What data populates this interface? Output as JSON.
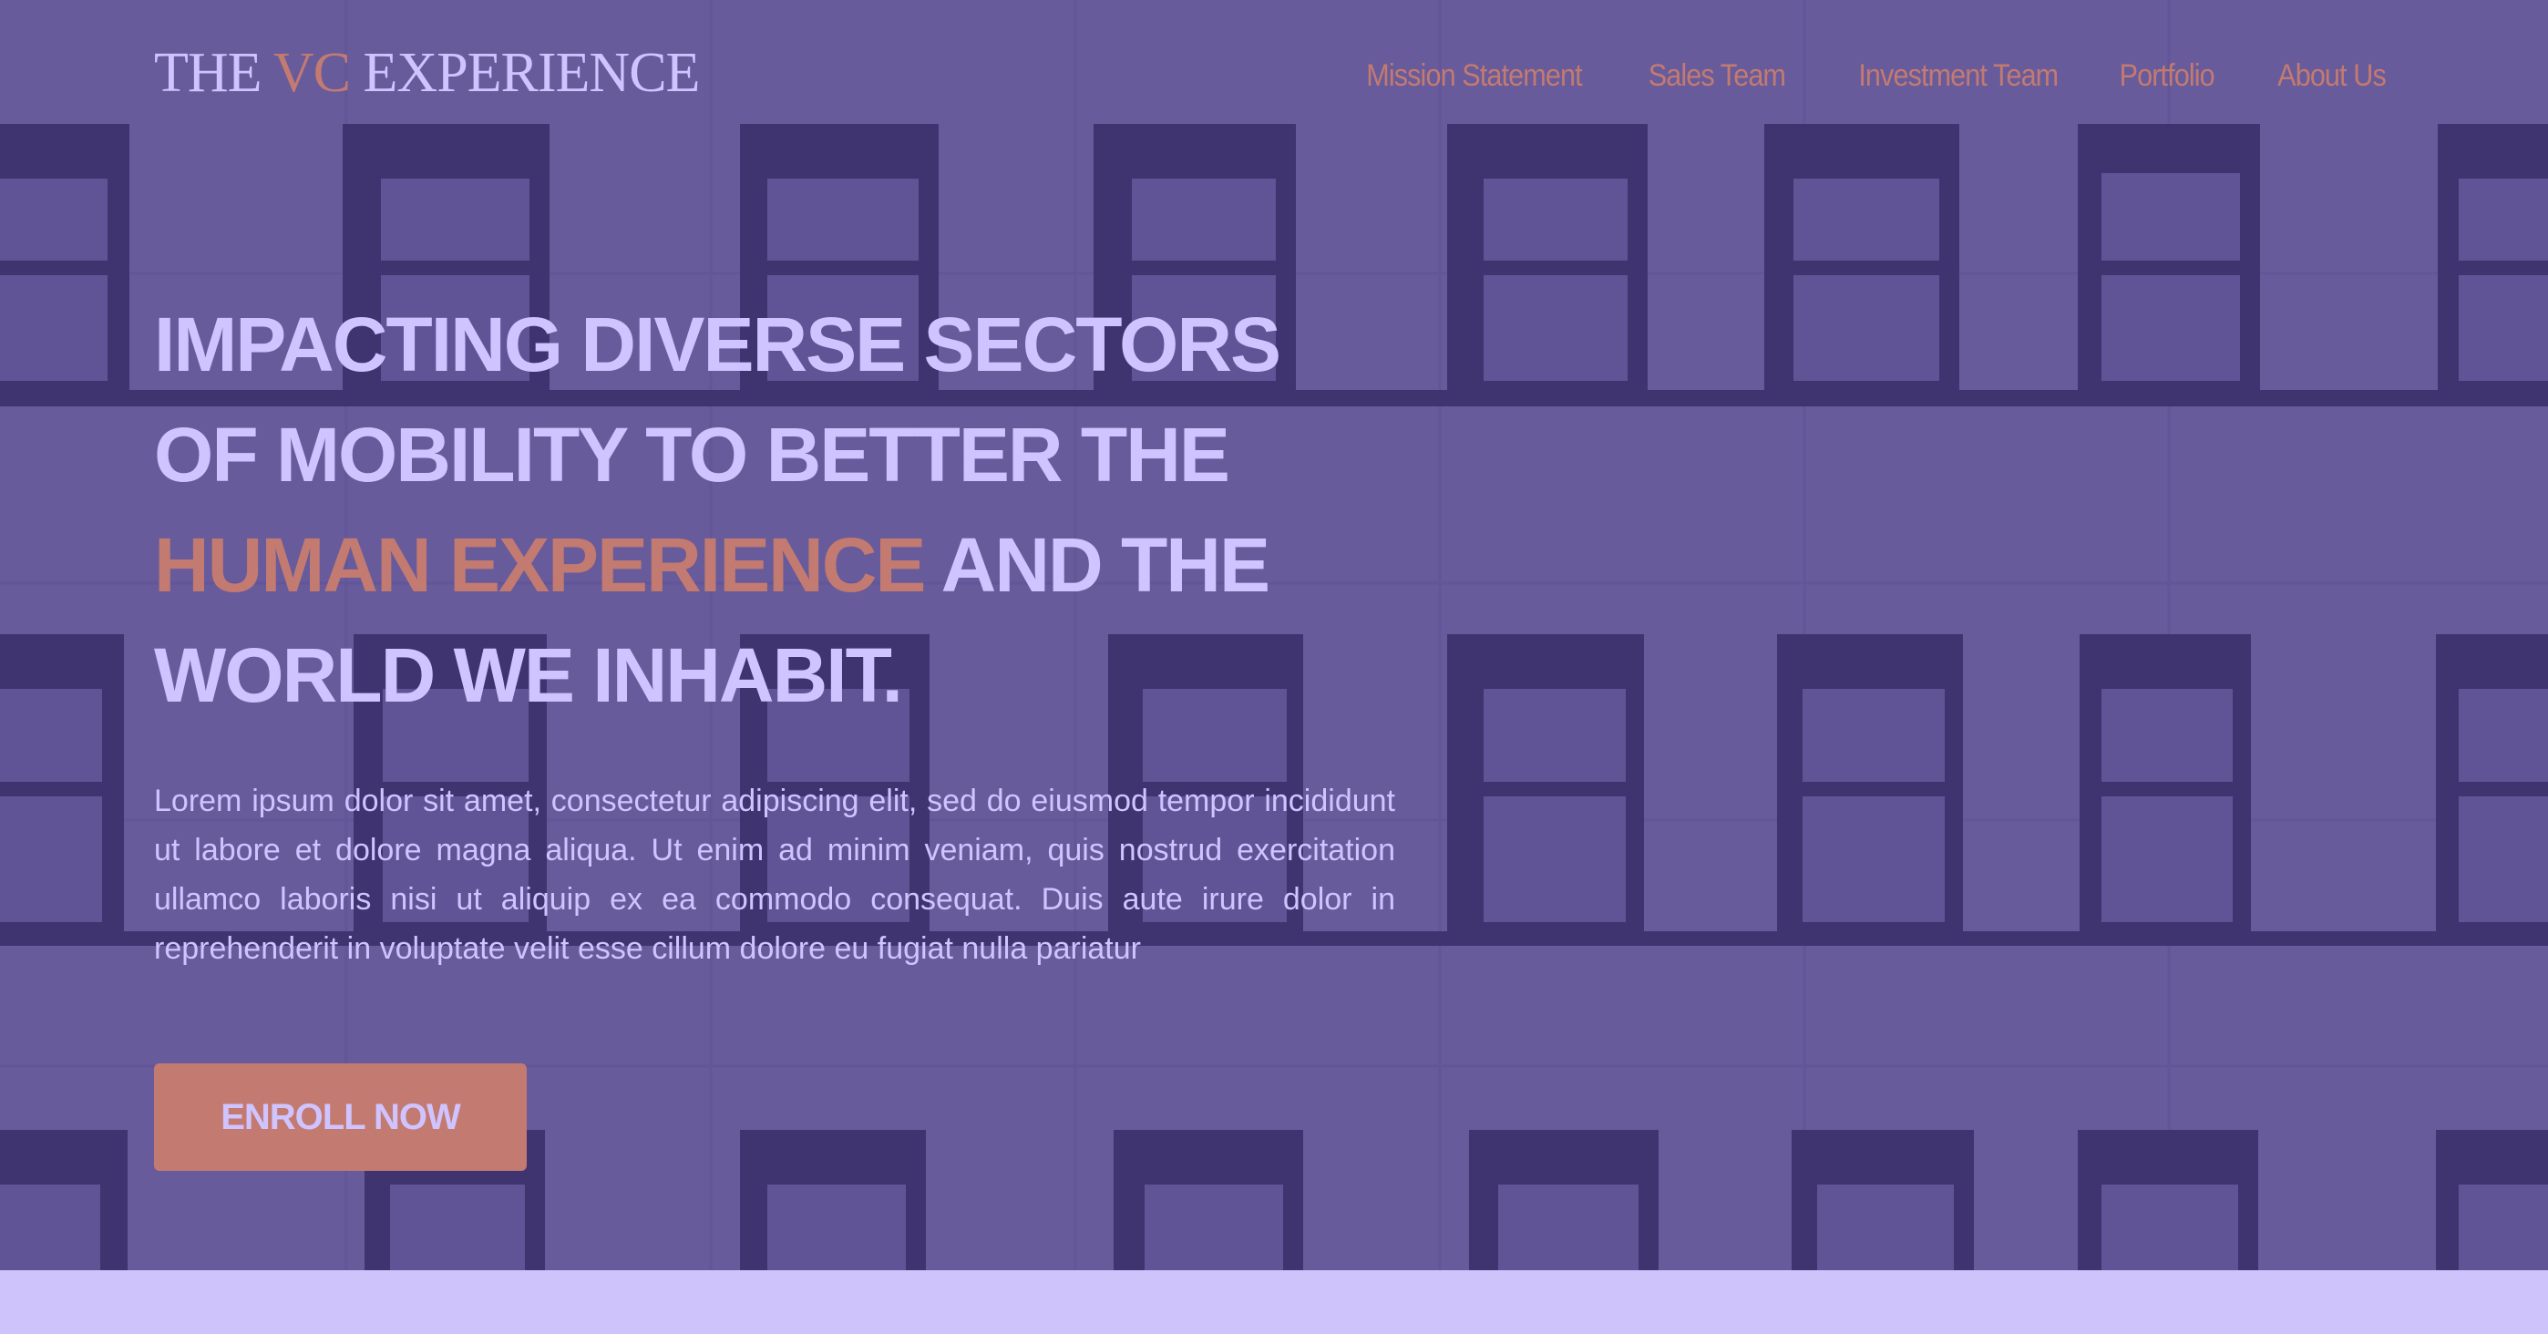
{
  "brand": {
    "part1": "THE ",
    "part2": "VC",
    "part3": " EXPERIENCE"
  },
  "nav": {
    "items": [
      {
        "label": "Mission Statement"
      },
      {
        "label": "Sales Team"
      },
      {
        "label": "Investment Team"
      },
      {
        "label": "Portfolio"
      },
      {
        "label": "About Us"
      }
    ]
  },
  "hero": {
    "headline_part1": "Impacting diverse sectors of mobility to better the ",
    "headline_highlight": "human experience",
    "headline_part2": " and the world we inhabit.",
    "body": "Lorem ipsum dolor sit amet, consectetur adipiscing elit, sed do eiusmod tempor incididunt ut labore et dolore magna aliqua. Ut enim ad minim veniam, quis nostrud exercitation ullamco laboris nisi ut aliquip ex ea commodo consequat. Duis aute irure dolor in reprehenderit in voluptate velit esse cillum dolore eu fugiat nulla pariatur",
    "cta_label": "ENROLL NOW"
  },
  "colors": {
    "overlay": "#675b9c",
    "text": "#cfc4ff",
    "accent": "#c37a70",
    "window": "#3f3470",
    "band": "#cec4fb"
  }
}
